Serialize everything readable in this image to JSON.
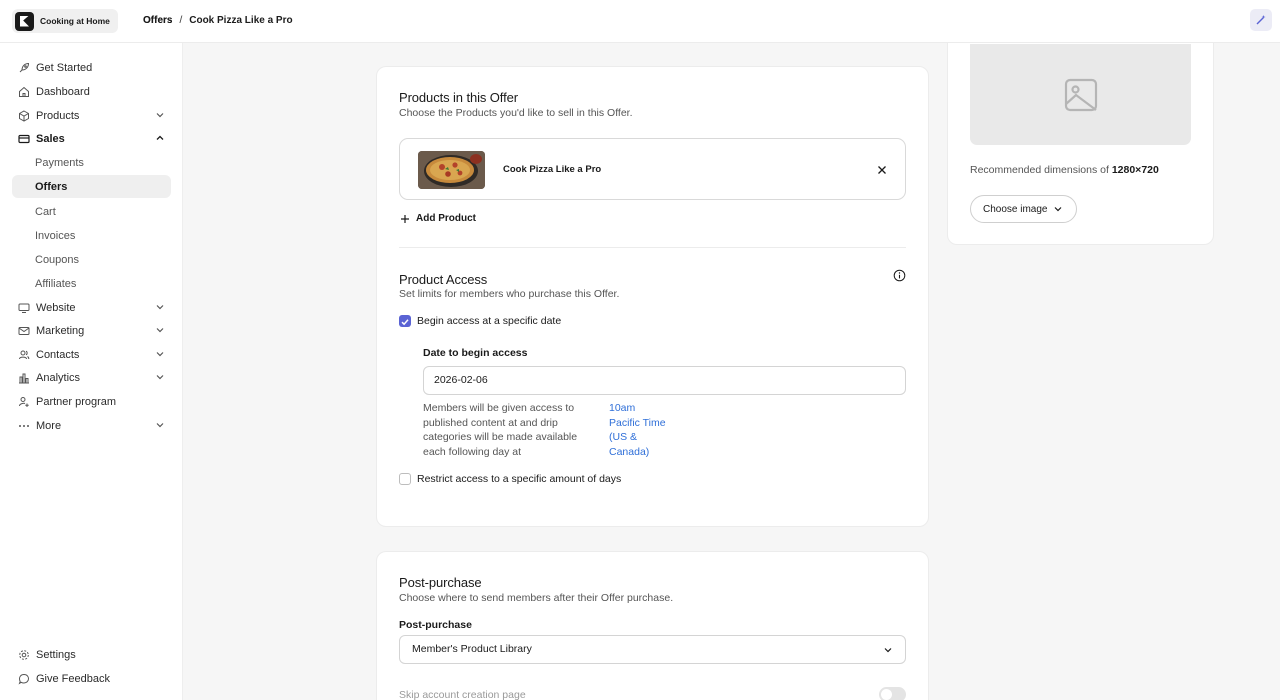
{
  "topbar": {
    "brand_name": "Cooking at Home",
    "breadcrumb": [
      "Offers",
      "Cook Pizza Like a Pro"
    ]
  },
  "sidebar": {
    "items": [
      {
        "label": "Get Started",
        "icon": "rocket-icon"
      },
      {
        "label": "Dashboard",
        "icon": "home-icon"
      },
      {
        "label": "Products",
        "icon": "box-icon",
        "expandable": true
      },
      {
        "label": "Sales",
        "icon": "credit-card-icon",
        "expanded": true
      },
      {
        "label": "Website",
        "icon": "monitor-icon",
        "expandable": true
      },
      {
        "label": "Marketing",
        "icon": "mail-icon",
        "expandable": true
      },
      {
        "label": "Contacts",
        "icon": "users-icon",
        "expandable": true
      },
      {
        "label": "Analytics",
        "icon": "chart-icon",
        "expandable": true
      },
      {
        "label": "Partner program",
        "icon": "partner-icon"
      },
      {
        "label": "More",
        "icon": "ellipsis-icon",
        "expandable": true
      }
    ],
    "sales_sub": [
      "Payments",
      "Offers",
      "Cart",
      "Invoices",
      "Coupons",
      "Affiliates"
    ],
    "active_sub": "Offers",
    "footer": [
      {
        "label": "Settings",
        "icon": "gear-icon"
      },
      {
        "label": "Give Feedback",
        "icon": "chat-icon"
      }
    ]
  },
  "products_section": {
    "title": "Products in this Offer",
    "subtitle": "Choose the Products you'd like to sell in this Offer.",
    "product_name": "Cook Pizza Like a Pro",
    "add_label": "Add Product"
  },
  "access_section": {
    "title": "Product Access",
    "subtitle": "Set limits for members who purchase this Offer.",
    "begin_label": "Begin access at a specific date",
    "begin_checked": true,
    "date_label": "Date to begin access",
    "date_value": "2026-02-06",
    "help_text": "Members will be given access to published content at and drip categories will be made available each following day at",
    "help_link": "10am Pacific Time (US & Canada)",
    "restrict_label": "Restrict access to a specific amount of days",
    "restrict_checked": false
  },
  "post_purchase": {
    "title": "Post-purchase",
    "subtitle": "Choose where to send members after their Offer purchase.",
    "select_label": "Post-purchase",
    "select_value": "Member's Product Library",
    "skip_label": "Skip account creation page"
  },
  "image_panel": {
    "rec_prefix": "Recommended dimensions of ",
    "rec_dims": "1280×720",
    "choose_label": "Choose image"
  },
  "colors": {
    "accent": "#5a63d4",
    "link": "#2f6fd8"
  }
}
